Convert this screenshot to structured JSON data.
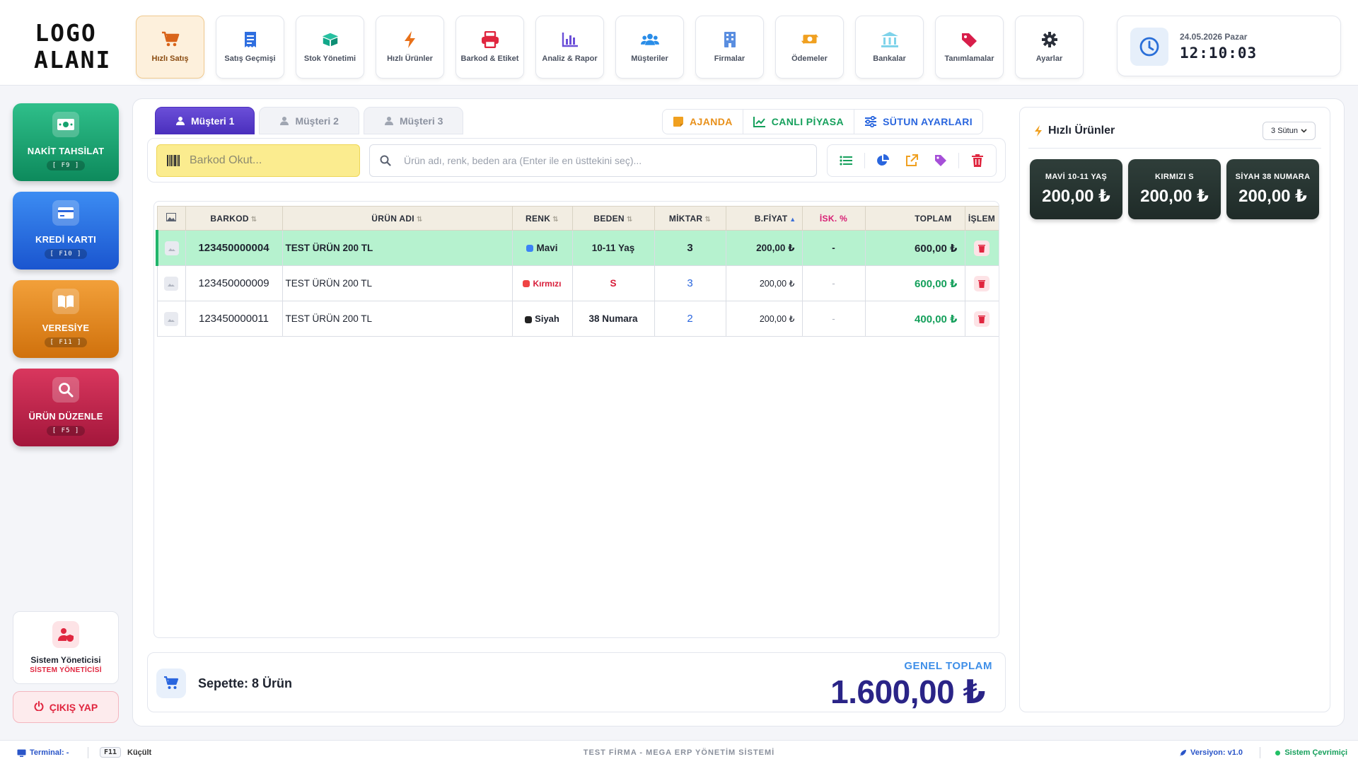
{
  "logo": {
    "line1": "LOGO",
    "line2": "ALANI"
  },
  "nav": [
    {
      "label": "Hızlı Satış",
      "icon": "cart-icon",
      "color": "#d9641a",
      "active": true
    },
    {
      "label": "Satış Geçmişi",
      "icon": "receipt-icon",
      "color": "#2f6fe0"
    },
    {
      "label": "Stok Yönetimi",
      "icon": "boxes-icon",
      "color": "#12a88a"
    },
    {
      "label": "Hızlı Ürünler",
      "icon": "bolt-icon",
      "color": "#e8711a"
    },
    {
      "label": "Barkod & Etiket",
      "icon": "printer-icon",
      "color": "#e0263f"
    },
    {
      "label": "Analiz & Rapor",
      "icon": "bar-chart-icon",
      "color": "#6b4fd8"
    },
    {
      "label": "Müşteriler",
      "icon": "users-icon",
      "color": "#2a8de8"
    },
    {
      "label": "Firmalar",
      "icon": "building-icon",
      "color": "#5a8ee0"
    },
    {
      "label": "Ödemeler",
      "icon": "money-exchange-icon",
      "color": "#f0a020"
    },
    {
      "label": "Bankalar",
      "icon": "bank-icon",
      "color": "#4ab8d8"
    },
    {
      "label": "Tanımlamalar",
      "icon": "tags-icon",
      "color": "#d81e4a"
    },
    {
      "label": "Ayarlar",
      "icon": "gear-icon",
      "color": "#2a2f3a"
    }
  ],
  "clock": {
    "date": "24.05.2026 Pazar",
    "time": "12:10:03"
  },
  "payments": [
    {
      "label": "NAKİT TAHSİLAT",
      "key": "[ F9 ]",
      "icon": "cash-icon"
    },
    {
      "label": "KREDİ KARTI",
      "key": "[ F10 ]",
      "icon": "credit-card-icon"
    },
    {
      "label": "VERESİYE",
      "key": "[ F11 ]",
      "icon": "book-icon"
    },
    {
      "label": "ÜRÜN DÜZENLE",
      "key": "[ F5 ]",
      "icon": "search-icon"
    }
  ],
  "user": {
    "name": "Sistem Yöneticisi",
    "role": "SİSTEM YÖNETİCİSİ"
  },
  "logout_label": "ÇIKIŞ YAP",
  "tabs": [
    {
      "label": "Müşteri 1",
      "active": true
    },
    {
      "label": "Müşteri 2"
    },
    {
      "label": "Müşteri 3"
    }
  ],
  "tools": {
    "agenda": "AJANDA",
    "market": "CANLI PİYASA",
    "columns": "SÜTUN AYARLARI"
  },
  "search": {
    "barcode_placeholder": "Barkod Okut...",
    "product_placeholder": "Ürün adı, renk, beden ara (Enter ile en üsttekini seç)..."
  },
  "table": {
    "headers": [
      "BARKOD",
      "ÜRÜN ADI",
      "RENK",
      "BEDEN",
      "MİKTAR",
      "B.FİYAT",
      "İSK. %",
      "TOPLAM",
      "İŞLEM"
    ],
    "rows": [
      {
        "barcode": "123450000004",
        "name": "TEST ÜRÜN 200 TL",
        "color": "Mavi",
        "color_hex": "#3b82f6",
        "size": "10-11 Yaş",
        "qty": "3",
        "price": "200,00 ₺",
        "discount": "-",
        "total": "600,00 ₺"
      },
      {
        "barcode": "123450000009",
        "name": "TEST ÜRÜN 200 TL",
        "color": "Kırmızı",
        "color_hex": "#ef4444",
        "size": "S",
        "qty": "3",
        "price": "200,00 ₺",
        "discount": "-",
        "total": "600,00 ₺"
      },
      {
        "barcode": "123450000011",
        "name": "TEST ÜRÜN 200 TL",
        "color": "Siyah",
        "color_hex": "#222222",
        "size": "38 Numara",
        "qty": "2",
        "price": "200,00 ₺",
        "discount": "-",
        "total": "400,00 ₺"
      }
    ]
  },
  "cart": {
    "count_label": "Sepette: 8 Ürün",
    "total_label": "GENEL TOPLAM",
    "total": "1.600,00 ₺"
  },
  "quick": {
    "title": "Hızlı Ürünler",
    "columns_option": "3 Sütun",
    "items": [
      {
        "name": "MAVİ 10-11 YAŞ",
        "price": "200,00 ₺"
      },
      {
        "name": "KIRMIZI S",
        "price": "200,00 ₺"
      },
      {
        "name": "SİYAH 38 NUMARA",
        "price": "200,00 ₺"
      }
    ]
  },
  "status": {
    "terminal": "Terminal: -",
    "key": "F11",
    "key_label": "Küçült",
    "company": "TEST FİRMA - MEGA ERP YÖNETİM SİSTEMİ",
    "version": "Versiyon: v1.0",
    "online": "Sistem Çevrimiçi"
  }
}
